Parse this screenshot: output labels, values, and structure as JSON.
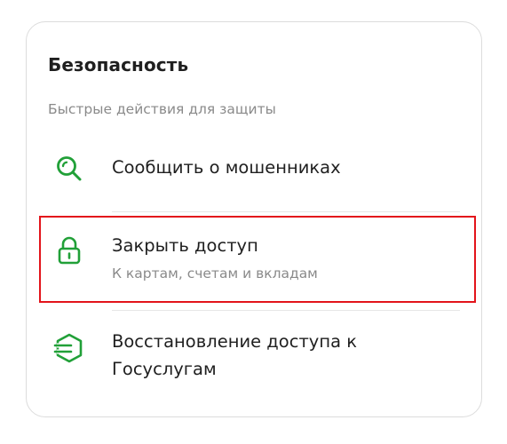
{
  "card": {
    "title": "Безопасность",
    "subtitle": "Быстрые действия для защиты",
    "items": [
      {
        "label": "Сообщить о мошенниках",
        "icon": "search-icon"
      },
      {
        "label": "Закрыть доступ",
        "sublabel": "К картам, счетам и вкладам",
        "icon": "lock-icon"
      },
      {
        "label_line1": "Восстановление доступа к",
        "label_line2": "Госуслугам",
        "icon": "gosuslugi-icon"
      }
    ]
  },
  "colors": {
    "accent": "#21a038",
    "highlight": "#e3141b",
    "text": "#1f1f1f",
    "muted": "#8a8a8a"
  }
}
